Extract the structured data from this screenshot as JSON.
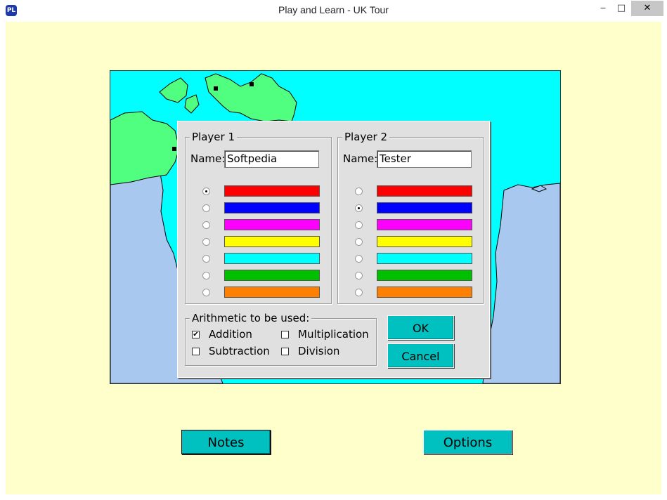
{
  "window": {
    "title": "Play and Learn - UK Tour",
    "icon_text": "PL",
    "minimize": "‒",
    "maximize": "□",
    "close": "✕"
  },
  "dialog": {
    "player1": {
      "title": "Player 1",
      "name_label": "Name:",
      "name_value": "Softpedia",
      "selected_color": 0
    },
    "player2": {
      "title": "Player 2",
      "name_label": "Name:",
      "name_value": "Tester",
      "selected_color": 1
    },
    "colors": [
      "#ff0000",
      "#0000ff",
      "#ff00ff",
      "#ffff00",
      "#00ffff",
      "#00c000",
      "#ff8000"
    ],
    "arithmetic": {
      "title": "Arithmetic to be used:",
      "options": [
        {
          "label": "Addition",
          "checked": true
        },
        {
          "label": "Multiplication",
          "checked": false
        },
        {
          "label": "Subtraction",
          "checked": false
        },
        {
          "label": "Division",
          "checked": false
        }
      ]
    },
    "ok_label": "OK",
    "cancel_label": "Cancel"
  },
  "buttons": {
    "notes": "Notes",
    "options": "Options"
  },
  "colors": {
    "background": "#ffffcc",
    "sea": "#00ffff",
    "land_uk": "#50ff80",
    "land_other": "#a8c8f0",
    "button": "#00c0c0"
  }
}
